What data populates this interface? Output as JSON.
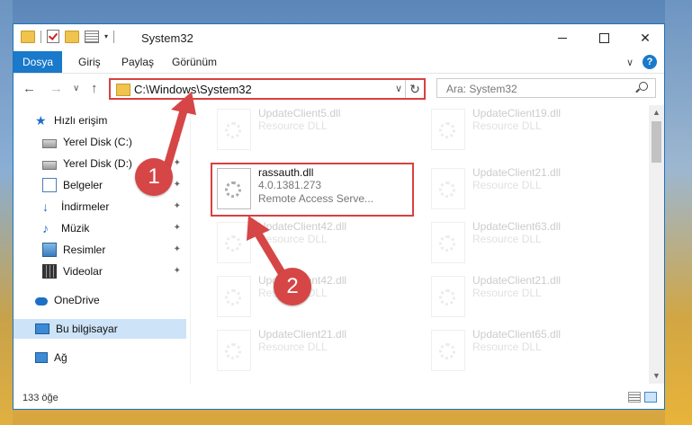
{
  "window": {
    "title": "System32",
    "controls": {
      "minimize": "minimize-icon",
      "maximize": "maximize-icon",
      "close": "✕"
    }
  },
  "ribbon": {
    "tabs": [
      {
        "label": "Dosya",
        "active": true
      },
      {
        "label": "Giriş",
        "active": false
      },
      {
        "label": "Paylaş",
        "active": false
      },
      {
        "label": "Görünüm",
        "active": false
      }
    ],
    "expand_glyph": "∨",
    "help_glyph": "?"
  },
  "navbar": {
    "back": "←",
    "forward": "→",
    "recent": "∨",
    "up": "↑",
    "address": "C:\\Windows\\System32",
    "address_chevron": "∨",
    "refresh": "↻",
    "search_placeholder": "Ara: System32"
  },
  "sidebar": {
    "items": [
      {
        "label": "Hızlı erişim",
        "icon": "star-icon",
        "pinned": false
      },
      {
        "label": "Yerel Disk (C:)",
        "icon": "drive-icon",
        "pinned": true
      },
      {
        "label": "Yerel Disk (D:)",
        "icon": "drive-icon",
        "pinned": true
      },
      {
        "label": "Belgeler",
        "icon": "documents-icon",
        "pinned": true
      },
      {
        "label": "İndirmeler",
        "icon": "downloads-icon",
        "pinned": true
      },
      {
        "label": "Müzik",
        "icon": "music-icon",
        "pinned": true
      },
      {
        "label": "Resimler",
        "icon": "pictures-icon",
        "pinned": true
      },
      {
        "label": "Videolar",
        "icon": "videos-icon",
        "pinned": true
      },
      {
        "label": "OneDrive",
        "icon": "cloud-icon",
        "pinned": false
      },
      {
        "label": "Bu bilgisayar",
        "icon": "computer-icon",
        "pinned": false,
        "selected": true
      },
      {
        "label": "Ağ",
        "icon": "network-icon",
        "pinned": false
      }
    ],
    "pin_glyph": "📌"
  },
  "files": {
    "left": [
      {
        "name": "UpdateClient5.dll",
        "desc": "Resource DLL",
        "faded": true
      },
      {
        "name": "rassauth.dll",
        "version": "4.0.1381.273",
        "desc": "Remote Access Serve...",
        "faded": false
      },
      {
        "name": "UpdateClient42.dll",
        "desc": "Resource DLL",
        "faded": true
      },
      {
        "name": "UpdateClient42.dll",
        "desc": "Resource DLL",
        "faded": true
      },
      {
        "name": "UpdateClient21.dll",
        "desc": "Resource DLL",
        "faded": true
      }
    ],
    "right": [
      {
        "name": "UpdateClient19.dll",
        "desc": "Resource DLL",
        "faded": true
      },
      {
        "name": "UpdateClient21.dll",
        "desc": "Resource DLL",
        "faded": true
      },
      {
        "name": "UpdateClient63.dll",
        "desc": "Resource DLL",
        "faded": true
      },
      {
        "name": "UpdateClient21.dll",
        "desc": "Resource DLL",
        "faded": true
      },
      {
        "name": "UpdateClient65.dll",
        "desc": "Resource DLL",
        "faded": true
      }
    ]
  },
  "status": {
    "count": "133 öğe"
  },
  "markers": [
    {
      "label": "1"
    },
    {
      "label": "2"
    }
  ],
  "colors": {
    "accent": "#1979ca",
    "highlight": "#d94040"
  }
}
